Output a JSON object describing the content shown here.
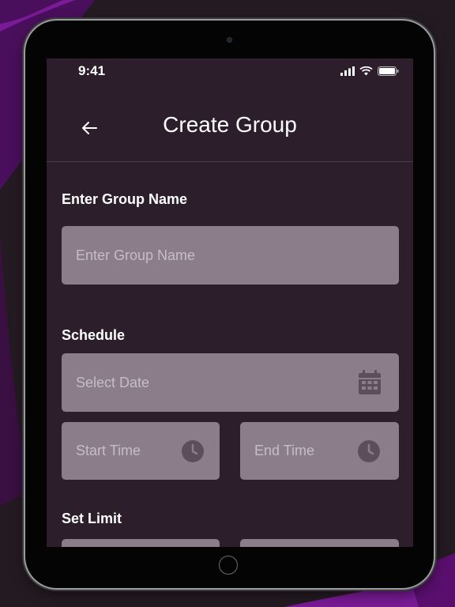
{
  "status_bar": {
    "time": "9:41",
    "icons": [
      "signal-icon",
      "wifi-icon",
      "battery-icon"
    ]
  },
  "header": {
    "title": "Create Group",
    "back_icon": "back-arrow-icon"
  },
  "group_name": {
    "label": "Enter Group Name",
    "placeholder": "Enter Group Name"
  },
  "schedule": {
    "label": "Schedule",
    "date_placeholder": "Select Date",
    "start_placeholder": "Start Time",
    "end_placeholder": "End Time",
    "date_icon": "calendar-icon",
    "time_icon": "clock-icon"
  },
  "limit": {
    "label": "Set Limit"
  },
  "colors": {
    "background": "#2c1f2b",
    "field": "#8b7d8a",
    "placeholder": "#c7bdc6",
    "text": "#ffffff",
    "accent_purple": "#5a0f6e"
  }
}
